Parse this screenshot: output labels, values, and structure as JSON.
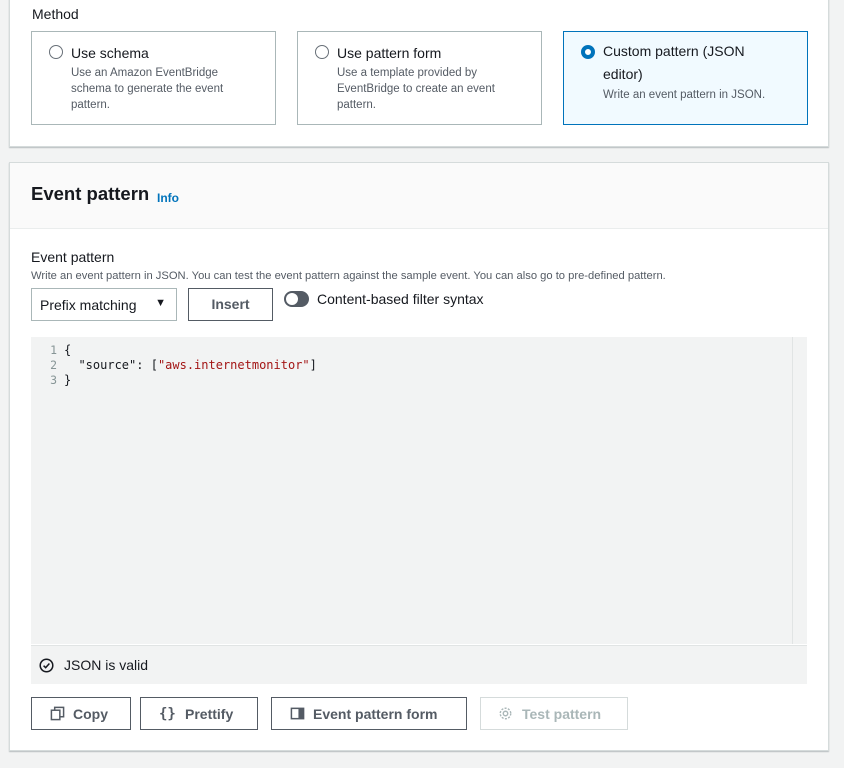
{
  "method": {
    "label": "Method",
    "options": [
      {
        "title": "Use schema",
        "desc": [
          "Use an Amazon EventBridge",
          "schema to generate the event",
          "pattern."
        ],
        "selected": false
      },
      {
        "title": "Use pattern form",
        "desc": [
          "Use a template provided by",
          "EventBridge to create an event",
          "pattern."
        ],
        "selected": false
      },
      {
        "title": [
          "Custom pattern (JSON",
          "editor)"
        ],
        "desc": [
          "Write an event pattern in JSON."
        ],
        "selected": true
      }
    ]
  },
  "event_pattern": {
    "panel_title": "Event pattern",
    "info_link": "Info",
    "field_label": "Event pattern",
    "field_desc": "Write an event pattern in JSON. You can test the event pattern against the sample event. You can also go to pre-defined pattern.",
    "select_value": "Prefix matching",
    "insert_label": "Insert",
    "toggle_label": "Content-based filter syntax",
    "toggle_on": false,
    "editor": {
      "line_numbers": [
        "1",
        "2",
        "3"
      ],
      "lines": [
        "{",
        "  \"source\": [\"aws.internetmonitor\"]",
        "}"
      ],
      "code_key": "\"source\"",
      "code_value": "\"aws.internetmonitor\""
    },
    "status": "JSON is valid",
    "buttons": {
      "copy": "Copy",
      "prettify": "Prettify",
      "form": "Event pattern form",
      "test": "Test pattern"
    }
  },
  "colors": {
    "accent": "#0073bb",
    "selected_bg": "#f1faff",
    "string": "#a31515",
    "disabled": "#aab7b8"
  },
  "icons": {
    "radio": "radio-icon",
    "caret": "caret-down-icon",
    "check": "check-circle-icon",
    "copy": "copy-icon",
    "prettify": "curly-braces-icon",
    "form": "form-panel-icon",
    "test": "gear-icon"
  }
}
